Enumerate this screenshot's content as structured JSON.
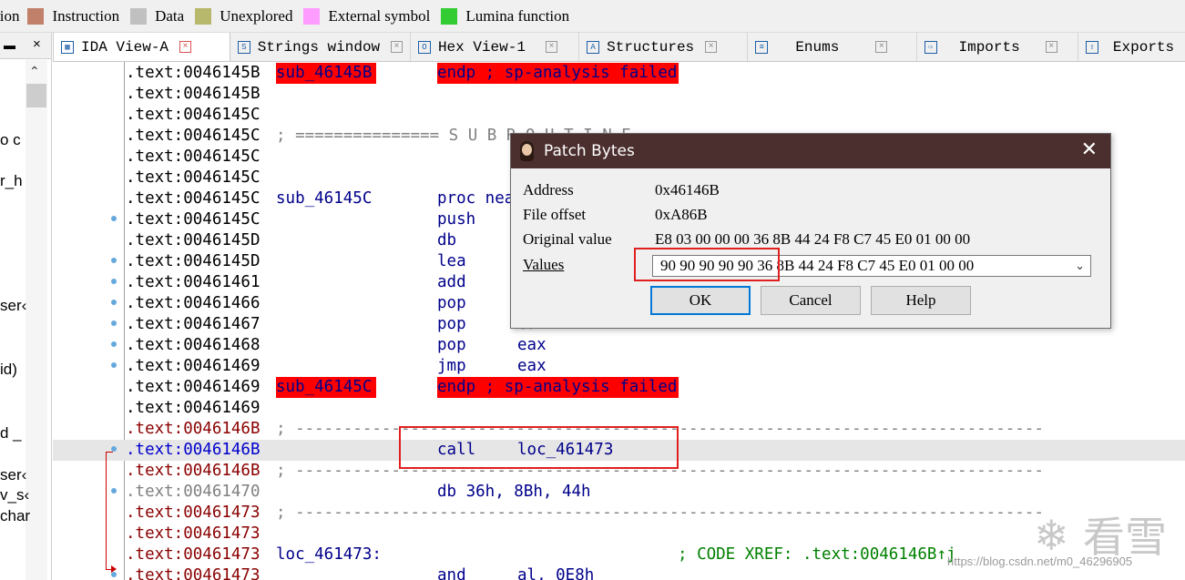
{
  "legend": {
    "items": [
      {
        "label": "Instruction",
        "color": "#c0806a",
        "leading": "tion"
      },
      {
        "label": "Instruction",
        "color": "#c0806a"
      },
      {
        "label": "Data",
        "color": "#c0c0c0"
      },
      {
        "label": "Unexplored",
        "color": "#b8b86c"
      },
      {
        "label": "External symbol",
        "color": "#ff9cff"
      },
      {
        "label": "Lumina function",
        "color": "#33cc33"
      }
    ]
  },
  "left_panel": {
    "close": "×",
    "fragments": [
      "o c",
      "r_h",
      "ser‹",
      "id)",
      "d _",
      "ser‹",
      "v_s‹",
      "char"
    ]
  },
  "tabs": [
    {
      "label": "IDA View-A",
      "icon": "ida-view-icon",
      "active": true
    },
    {
      "label": "Strings window",
      "icon": "strings-icon"
    },
    {
      "label": "Hex View-1",
      "icon": "hex-icon"
    },
    {
      "label": "Structures",
      "icon": "structures-icon"
    },
    {
      "label": "Enums",
      "icon": "enums-icon"
    },
    {
      "label": "Imports",
      "icon": "imports-icon"
    },
    {
      "label": "Exports",
      "icon": "exports-icon"
    }
  ],
  "code": {
    "lines": [
      {
        "addr": ".text:0046145B",
        "lbl": "sub_46145B",
        "endp": "endp ; sp-analysis failed",
        "addr_color": "norm"
      },
      {
        "addr": ".text:0046145B",
        "addr_color": "norm"
      },
      {
        "addr": ".text:0046145C",
        "addr_color": "norm"
      },
      {
        "addr": ".text:0046145C",
        "cm": "; =============== S U B R O U T I N E",
        "addr_color": "norm"
      },
      {
        "addr": ".text:0046145C",
        "addr_color": "norm"
      },
      {
        "addr": ".text:0046145C",
        "addr_color": "norm"
      },
      {
        "addr": ".text:0046145C",
        "lbl": "sub_46145C",
        "mn": "proc near",
        "addr_color": "norm"
      },
      {
        "addr": ".text:0046145C",
        "mn": "push",
        "dot": true,
        "addr_color": "norm"
      },
      {
        "addr": ".text:0046145D",
        "mn": "db",
        "addr_color": "norm"
      },
      {
        "addr": ".text:0046145D",
        "mn": "lea",
        "dot": true,
        "addr_color": "norm"
      },
      {
        "addr": ".text:00461461",
        "mn": "add",
        "dot": true,
        "addr_color": "norm"
      },
      {
        "addr": ".text:00461466",
        "mn": "pop",
        "dot": true,
        "addr_color": "norm"
      },
      {
        "addr": ".text:00461467",
        "mn": "pop",
        "op": "eax",
        "dot": true,
        "addr_color": "norm"
      },
      {
        "addr": ".text:00461468",
        "mn": "pop",
        "op": "eax",
        "dot": true,
        "addr_color": "norm"
      },
      {
        "addr": ".text:00461469",
        "mn": "jmp",
        "op": "eax",
        "dot": true,
        "addr_color": "norm"
      },
      {
        "addr": ".text:00461469",
        "lbl": "sub_46145C",
        "endp": "endp ; sp-analysis failed",
        "addr_color": "norm"
      },
      {
        "addr": ".text:00461469",
        "addr_color": "norm"
      },
      {
        "addr": ".text:0046146B",
        "cm": "; ------------------------------------------------------------------------------",
        "addr_color": "brown"
      },
      {
        "addr": ".text:0046146B",
        "mn": "call",
        "op": "loc_461473",
        "dot": true,
        "hl": true,
        "addr_color": "blue"
      },
      {
        "addr": ".text:0046146B",
        "cm": "; ------------------------------------------------------------------------------",
        "addr_color": "brown"
      },
      {
        "addr": ".text:00461470",
        "mn": "db 36h, 8Bh, 44h",
        "dot": true,
        "addr_color": "gray"
      },
      {
        "addr": ".text:00461473",
        "cm": "; ------------------------------------------------------------------------------",
        "addr_color": "brown"
      },
      {
        "addr": ".text:00461473",
        "addr_color": "brown"
      },
      {
        "addr": ".text:00461473",
        "lbl": "loc_461473:",
        "xref": "; CODE XREF: .text:0046146B↑j",
        "addr_color": "brown"
      },
      {
        "addr": ".text:00461473",
        "mn": "and",
        "op": "al, 0E8h",
        "dot": true,
        "addr_color": "brown"
      }
    ]
  },
  "dialog": {
    "title": "Patch Bytes",
    "close": "✕",
    "address_label": "Address",
    "address_value": "0x46146B",
    "file_offset_label": "File offset",
    "file_offset_value": "0xA86B",
    "original_label": "Original value",
    "original_value": "E8 03 00 00 00 36 8B 44 24 F8 C7 45 E0 01 00 00",
    "values_label": "Values",
    "values_value": "90 90 90 90 90 36 8B 44 24 F8 C7 45 E0 01 00 00",
    "ok": "OK",
    "cancel": "Cancel",
    "help": "Help"
  },
  "watermark": {
    "url": "https://blog.csdn.net/m0_46296905",
    "logo_text": "看雪"
  },
  "colors": {
    "dialog_title_bg": "#4b2e2e",
    "endp_highlight": "#ff0000",
    "annotation_box": "#e02020"
  }
}
